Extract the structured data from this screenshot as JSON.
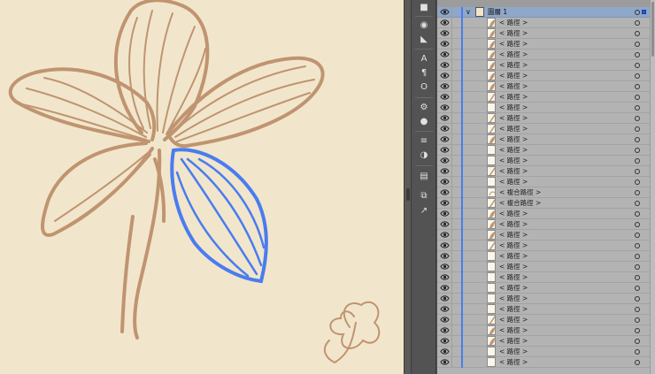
{
  "colors": {
    "canvas": "#f1e6cb",
    "artwork": "#c09470",
    "selection": "#4a7cf0",
    "panel": "#b3b3b3",
    "parent_row": "#8fa7c8"
  },
  "toolstrip": {
    "icons": [
      "speech-bubble-icon",
      "color-icon",
      "gradient-icon",
      "character-icon",
      "paragraph-icon",
      "opentype-icon",
      "gear-icon",
      "info-icon",
      "align-icon",
      "pathfinder-icon",
      "swatch-icon",
      "artboard-icon",
      "export-icon"
    ]
  },
  "layers": {
    "parent": {
      "label": "圖層 1"
    },
    "rows": [
      {
        "label": "< 路徑 >",
        "kind": "leaf"
      },
      {
        "label": "< 路徑 >",
        "kind": "leaf"
      },
      {
        "label": "< 路徑 >",
        "kind": "leaf"
      },
      {
        "label": "< 路徑 >",
        "kind": "leaf"
      },
      {
        "label": "< 路徑 >",
        "kind": "leaf"
      },
      {
        "label": "< 路徑 >",
        "kind": "leaf"
      },
      {
        "label": "< 路徑 >",
        "kind": "leaf"
      },
      {
        "label": "< 路徑 >",
        "kind": "stroke"
      },
      {
        "label": "< 路徑 >",
        "kind": "empty"
      },
      {
        "label": "< 路徑 >",
        "kind": "stroke"
      },
      {
        "label": "< 路徑 >",
        "kind": "stroke"
      },
      {
        "label": "< 路徑 >",
        "kind": "leaf"
      },
      {
        "label": "< 路徑 >",
        "kind": "empty"
      },
      {
        "label": "< 路徑 >",
        "kind": "empty"
      },
      {
        "label": "< 路徑 >",
        "kind": "stroke"
      },
      {
        "label": "< 路徑 >",
        "kind": "empty"
      },
      {
        "label": "< 複合路徑 >",
        "kind": "compound"
      },
      {
        "label": "< 複合路徑 >",
        "kind": "stroke"
      },
      {
        "label": "< 路徑 >",
        "kind": "leaf"
      },
      {
        "label": "< 路徑 >",
        "kind": "leaf"
      },
      {
        "label": "< 路徑 >",
        "kind": "leaf"
      },
      {
        "label": "< 路徑 >",
        "kind": "stroke"
      },
      {
        "label": "< 路徑 >",
        "kind": "empty"
      },
      {
        "label": "< 路徑 >",
        "kind": "empty"
      },
      {
        "label": "< 路徑 >",
        "kind": "empty"
      },
      {
        "label": "< 路徑 >",
        "kind": "empty"
      },
      {
        "label": "< 路徑 >",
        "kind": "empty"
      },
      {
        "label": "< 路徑 >",
        "kind": "empty"
      },
      {
        "label": "< 路徑 >",
        "kind": "stroke"
      },
      {
        "label": "< 路徑 >",
        "kind": "leaf"
      },
      {
        "label": "< 路徑 >",
        "kind": "leaf"
      },
      {
        "label": "< 路徑 >",
        "kind": "empty"
      },
      {
        "label": "< 路徑 >",
        "kind": "empty"
      }
    ]
  }
}
